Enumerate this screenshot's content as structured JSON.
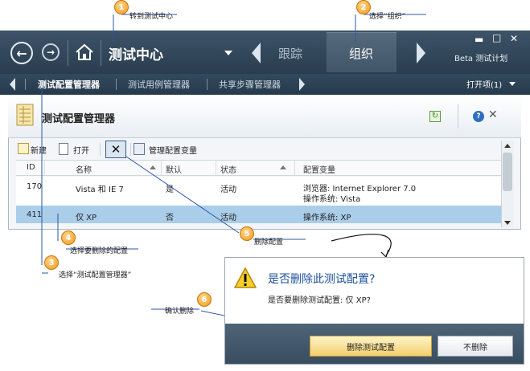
{
  "hub": {
    "title": "测试中心",
    "tabs": [
      {
        "label": "跟踪"
      },
      {
        "label": "组织"
      }
    ],
    "project": "Beta 测试计划",
    "window_controls": {
      "minimize": "▬",
      "maximize": "□",
      "close": "✕"
    }
  },
  "subnav": {
    "items": [
      {
        "label": "测试配置管理器"
      },
      {
        "label": "测试用例管理器"
      },
      {
        "label": "共享步骤管理器"
      }
    ],
    "open_items": "打开项(1)"
  },
  "panel": {
    "title": "测试配置管理器",
    "toolbar": {
      "new": "新建",
      "open": "打开",
      "manage_vars": "管理配置变量"
    }
  },
  "grid": {
    "columns": [
      "ID",
      "名称",
      "默认",
      "状态",
      "配置变量"
    ],
    "rows": [
      {
        "id": "170",
        "name": "Vista 和 IE 7",
        "default": "是",
        "status": "活动",
        "vars1": "浏览器: Internet Explorer 7.0",
        "vars2": "操作系统: Vista"
      },
      {
        "id": "411",
        "name": "仅 XP",
        "default": "否",
        "status": "活动",
        "vars1": "操作系统: XP",
        "vars2": ""
      }
    ]
  },
  "callouts": [
    {
      "num": "1",
      "text": "转到测试中心"
    },
    {
      "num": "2",
      "text": "选择“组织”"
    },
    {
      "num": "3",
      "text": "选择“测试配置管理器”"
    },
    {
      "num": "4",
      "text": "选择要删除的配置"
    },
    {
      "num": "5",
      "text": "删除配置"
    },
    {
      "num": "6",
      "text": "确认删除"
    }
  ],
  "dialog": {
    "title": "是否删除此测试配置?",
    "message": "是否要删除测试配置: 仅 XP?",
    "confirm": "删除测试配置",
    "cancel": "不删除"
  },
  "icons": [
    "back-icon",
    "forward-icon",
    "home-icon",
    "dropdown-arrow-icon",
    "refresh-icon",
    "help-icon",
    "close-icon",
    "warning-icon",
    "new-icon",
    "open-icon",
    "delete-icon",
    "manage-icon",
    "config-icon"
  ]
}
